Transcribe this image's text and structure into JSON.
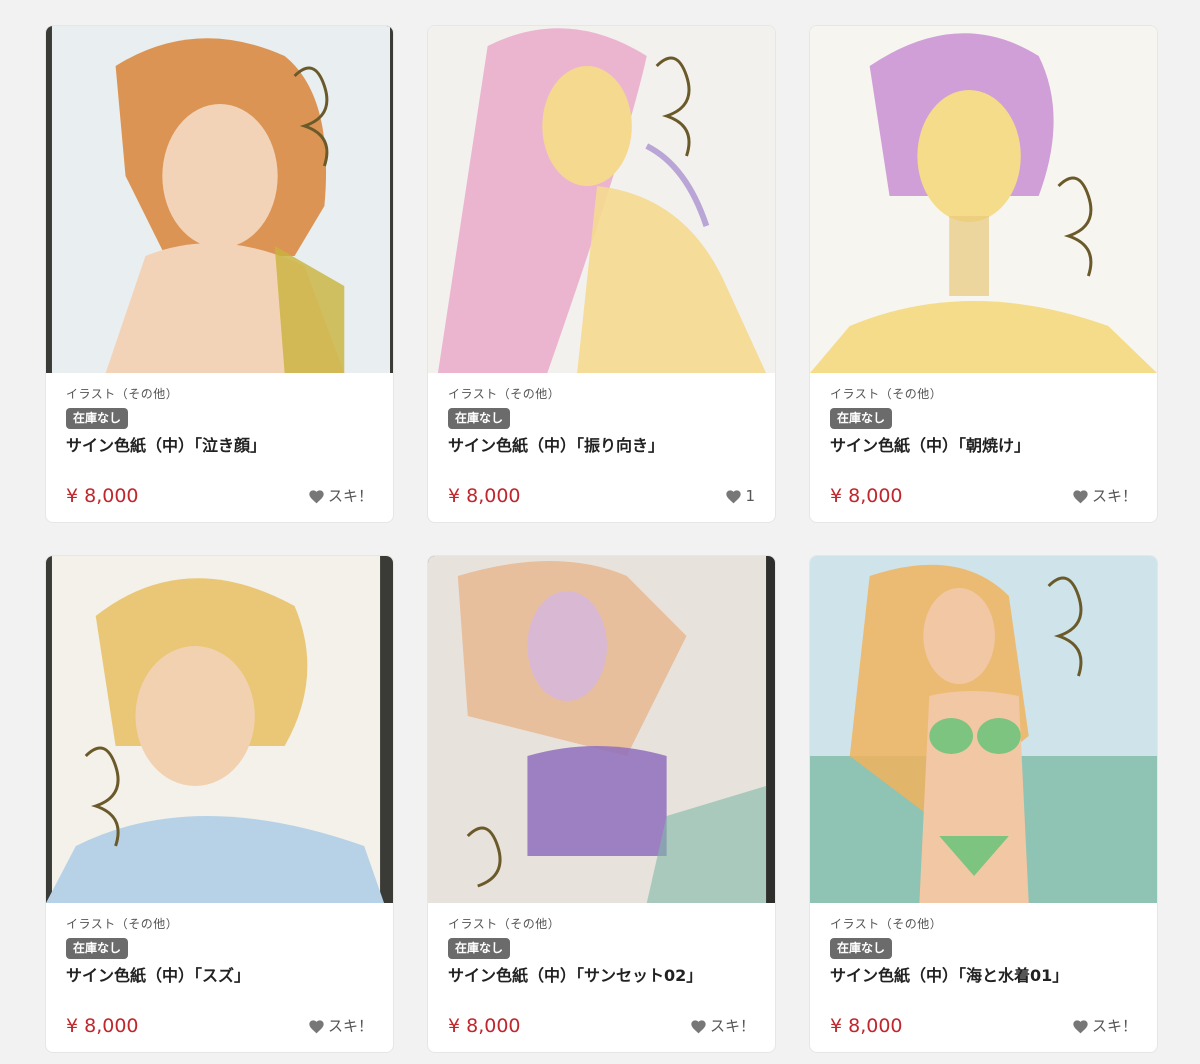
{
  "products": [
    {
      "category": "イラスト（その他）",
      "badge": "在庫なし",
      "title": "サイン色紙（中）「泣き顔」",
      "price": "¥ 8,000",
      "like": "スキ！",
      "palette": {
        "bg": "#e9eef0",
        "hair": "#d98a43",
        "skin": "#f3d3b7",
        "accent": "#c9b33c"
      }
    },
    {
      "category": "イラスト（その他）",
      "badge": "在庫なし",
      "title": "サイン色紙（中）「振り向き」",
      "price": "¥ 8,000",
      "like": "1",
      "palette": {
        "bg": "#f3f1ee",
        "hair": "#e9a6c8",
        "skin": "#f5d98f",
        "accent": "#b9a5d6"
      }
    },
    {
      "category": "イラスト（その他）",
      "badge": "在庫なし",
      "title": "サイン色紙（中）「朝焼け」",
      "price": "¥ 8,000",
      "like": "スキ！",
      "palette": {
        "bg": "#f7f5f0",
        "hair": "#c98fd3",
        "skin": "#f4dc8a",
        "accent": "#e8c97a"
      }
    },
    {
      "category": "イラスト（その他）",
      "badge": "在庫なし",
      "title": "サイン色紙（中）「スズ」",
      "price": "¥ 8,000",
      "like": "スキ！",
      "palette": {
        "bg": "#f4f1ea",
        "hair": "#e8c26a",
        "skin": "#f2d1b0",
        "accent": "#b7d2e6"
      }
    },
    {
      "category": "イラスト（その他）",
      "badge": "在庫なし",
      "title": "サイン色紙（中）「サンセット02」",
      "price": "¥ 8,000",
      "like": "スキ！",
      "palette": {
        "bg": "#e8e2dc",
        "hair": "#e7b991",
        "skin": "#d9b8d3",
        "accent": "#8f6fbd"
      }
    },
    {
      "category": "イラスト（その他）",
      "badge": "在庫なし",
      "title": "サイン色紙（中）「海と水着01」",
      "price": "¥ 8,000",
      "like": "スキ！",
      "palette": {
        "bg": "#cfe3ea",
        "hair": "#f0b45e",
        "skin": "#f2c7a4",
        "accent": "#7cc47f"
      }
    }
  ],
  "colors": {
    "price": "#c0272d",
    "badge_bg": "#6b6b6b",
    "page_bg": "#f2f2f2"
  },
  "icons": {
    "like": "heart-icon"
  }
}
